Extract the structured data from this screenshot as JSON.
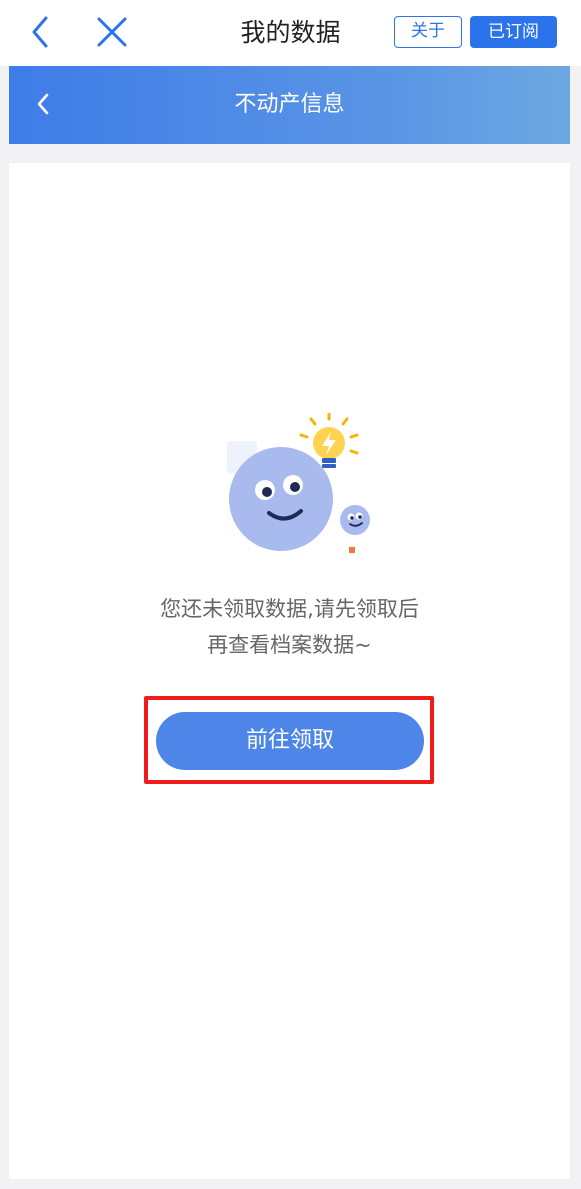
{
  "topbar": {
    "title": "我的数据",
    "about_label": "关于",
    "subscribed_label": "已订阅"
  },
  "header": {
    "title": "不动产信息"
  },
  "empty_state": {
    "line1": "您还未领取数据,请先领取后",
    "line2": "再查看档案数据~",
    "button_label": "前往领取"
  },
  "colors": {
    "accent": "#2a73ea",
    "header_gradient_start": "#3e7ce8",
    "header_gradient_end": "#6da8e2",
    "button": "#4d86e8",
    "highlight": "#f01b1b"
  }
}
